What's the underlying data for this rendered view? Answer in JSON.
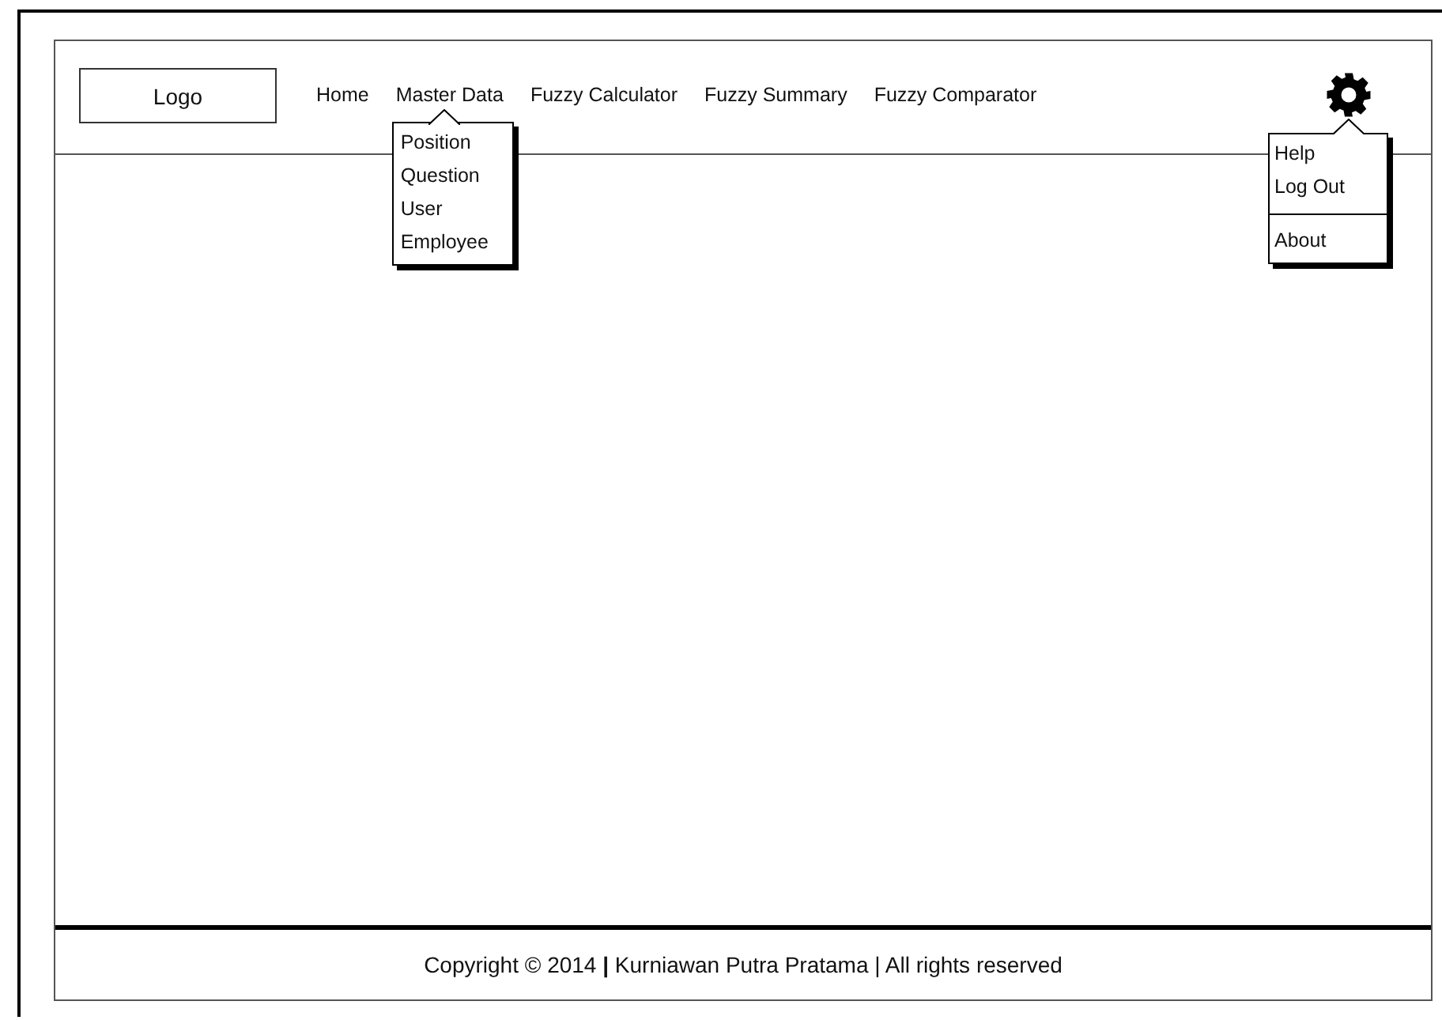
{
  "logo": "Logo",
  "nav": [
    {
      "label": "Home"
    },
    {
      "label": "Master Data",
      "menu": {
        "expanded": true,
        "items": [
          "Position",
          "Question",
          "User",
          "Employee"
        ]
      }
    },
    {
      "label": "Fuzzy Calculator"
    },
    {
      "label": "Fuzzy Summary"
    },
    {
      "label": "Fuzzy Comparator"
    }
  ],
  "settings": {
    "expanded": true,
    "menu_groups": [
      [
        "Help",
        "Log Out"
      ],
      [
        "About"
      ]
    ]
  },
  "footer": "Copyright © 2014 **|** Kurniawan Putra Pratama | All rights reserved"
}
